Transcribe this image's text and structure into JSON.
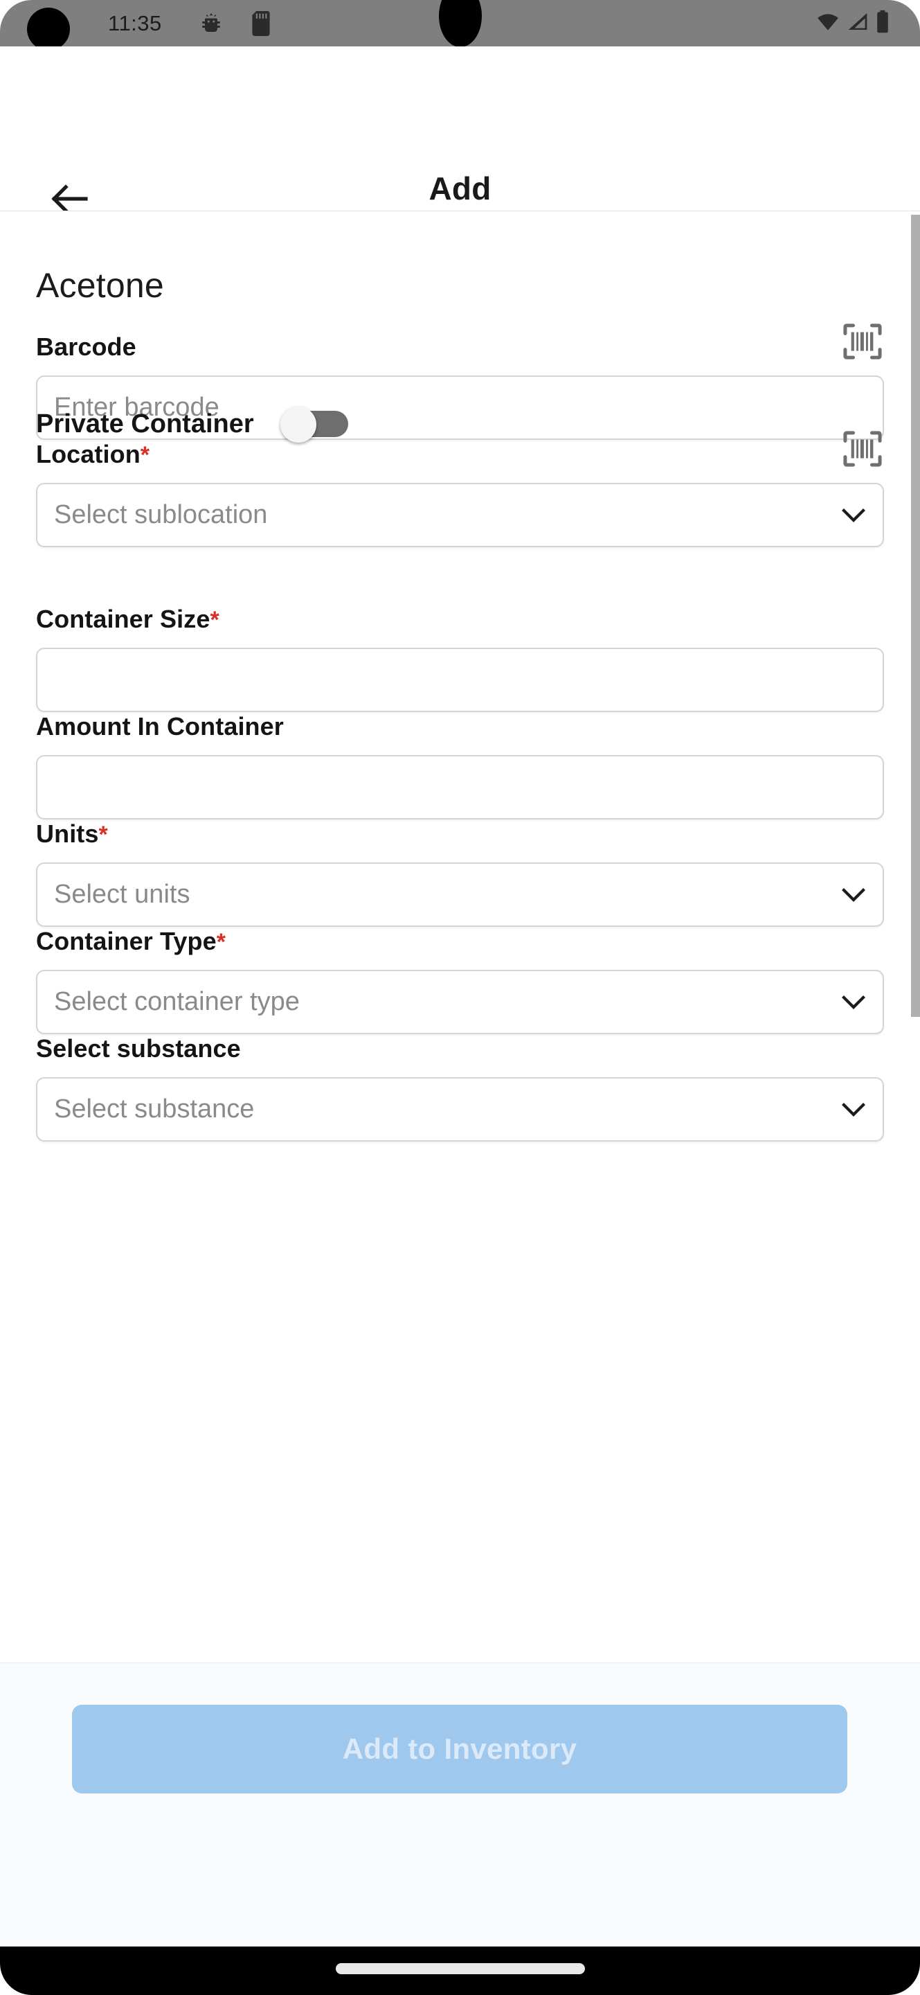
{
  "status_bar": {
    "time": "11:35",
    "icons": [
      "android-debug-icon",
      "sd-card-icon",
      "wifi-icon",
      "signal-icon",
      "battery-icon"
    ]
  },
  "app_bar": {
    "back_label": "back-arrow",
    "title": "Add"
  },
  "page": {
    "heading": "Acetone"
  },
  "form": {
    "barcode": {
      "label": "Barcode",
      "required": false,
      "placeholder": "Enter barcode",
      "value": "",
      "scan_icon": "barcode-scan-icon"
    },
    "location": {
      "label": "Location",
      "required": true,
      "required_mark": "*",
      "placeholder": "Select sublocation",
      "value": "",
      "scan_icon": "barcode-scan-icon"
    },
    "private_container": {
      "label": "Private Container",
      "state": "off"
    },
    "container_size": {
      "label": "Container Size",
      "required": true,
      "required_mark": "*",
      "placeholder": "",
      "value": ""
    },
    "amount_in_container": {
      "label": "Amount In Container",
      "required": false,
      "placeholder": "",
      "value": ""
    },
    "units": {
      "label": "Units",
      "required": true,
      "required_mark": "*",
      "placeholder": "Select units",
      "value": ""
    },
    "container_type": {
      "label": "Container Type",
      "required": true,
      "required_mark": "*",
      "placeholder": "Select container type",
      "value": ""
    },
    "substance": {
      "label": "Select substance",
      "required": false,
      "placeholder": "Select substance",
      "value": ""
    }
  },
  "bottom_bar": {
    "submit_label": "Add to Inventory",
    "submit_enabled": false
  },
  "colors": {
    "status_bar_bg": "#7f7f7f",
    "accent_disabled": "#9ec8ee",
    "accent_disabled_text": "#dbe9f8",
    "required_asterisk": "#d93025",
    "placeholder_text": "#8a8a8a",
    "field_border": "#d4d4d4",
    "toggle_track_off": "#6e6e6e",
    "nav_bar_bg": "#000000"
  }
}
